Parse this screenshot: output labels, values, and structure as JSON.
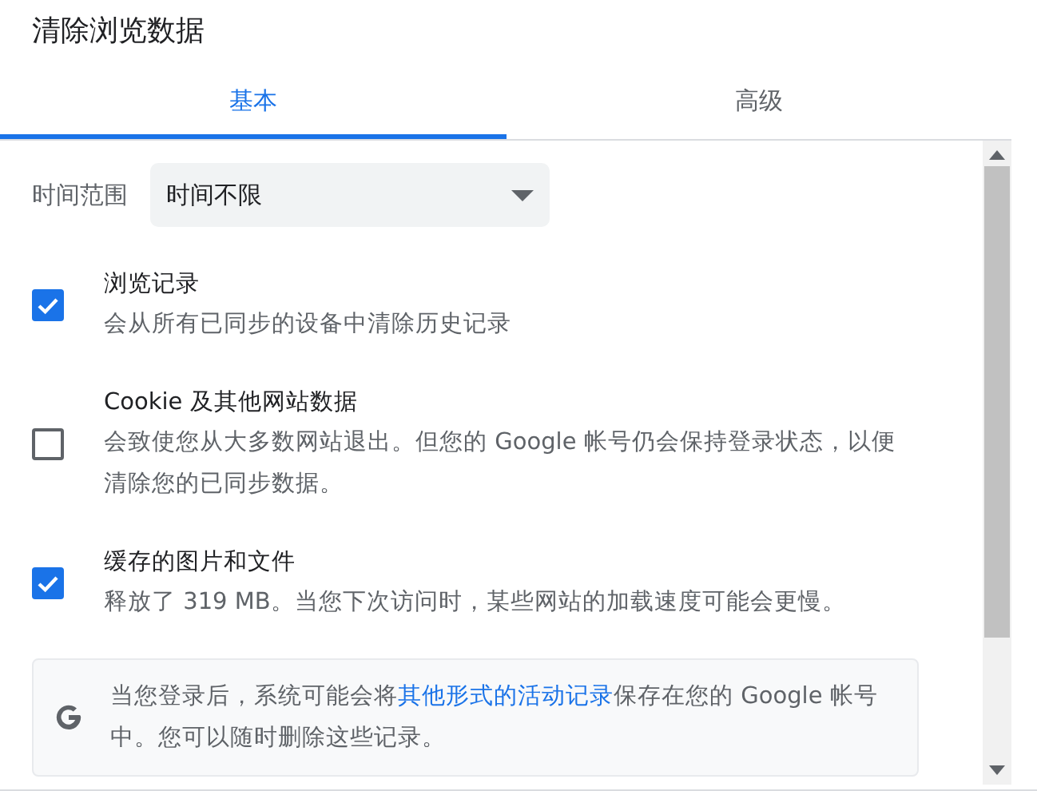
{
  "dialog": {
    "title": "清除浏览数据"
  },
  "tabs": [
    {
      "label": "基本",
      "selected": true
    },
    {
      "label": "高级",
      "selected": false
    }
  ],
  "time_range": {
    "label": "时间范围",
    "value": "时间不限"
  },
  "options": [
    {
      "title": "浏览记录",
      "description": "会从所有已同步的设备中清除历史记录",
      "checked": true
    },
    {
      "title": "Cookie 及其他网站数据",
      "description": "会致使您从大多数网站退出。但您的 Google 帐号仍会保持登录状态，以便清除您的已同步数据。",
      "checked": false
    },
    {
      "title": "缓存的图片和文件",
      "description": "释放了 319 MB。当您下次访问时，某些网站的加载速度可能会更慢。",
      "checked": true
    }
  ],
  "notice": {
    "text_before": "当您登录后，系统可能会将",
    "link": "其他形式的活动记录",
    "text_after": "保存在您的 Google 帐号中。您可以随时删除这些记录。"
  }
}
